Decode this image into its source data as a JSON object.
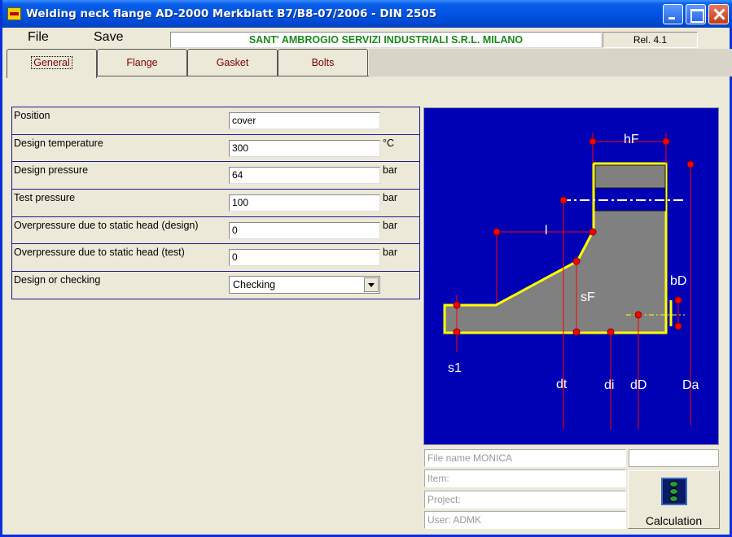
{
  "window": {
    "title": "Welding neck flange AD-2000 Merkblatt B7/B8-07/2006 - DIN 2505"
  },
  "menu": {
    "file": "File",
    "save": "Save"
  },
  "header": {
    "company": "SANT' AMBROGIO SERVIZI INDUSTRIALI S.R.L.   MILANO",
    "release": "Rel. 4.1"
  },
  "tabs": [
    {
      "label": "General",
      "active": true
    },
    {
      "label": "Flange",
      "active": false
    },
    {
      "label": "Gasket",
      "active": false
    },
    {
      "label": "Bolts",
      "active": false
    }
  ],
  "form": {
    "rows": [
      {
        "label": "Position",
        "value": "cover",
        "unit": ""
      },
      {
        "label": "Design temperature",
        "value": "300",
        "unit": "°C"
      },
      {
        "label": "Design pressure",
        "value": "64",
        "unit": "bar"
      },
      {
        "label": "Test pressure",
        "value": "100",
        "unit": "bar"
      },
      {
        "label": "Overpressure due to static head (design)",
        "value": "0",
        "unit": "bar"
      },
      {
        "label": "Overpressure due to static head (test)",
        "value": "0",
        "unit": "bar"
      },
      {
        "label": "Design or checking",
        "value": "Checking",
        "unit": ""
      }
    ]
  },
  "drawing": {
    "labels": {
      "hF": "hF",
      "l": "l",
      "sF": "sF",
      "bD": "bD",
      "s1": "s1",
      "dt": "dt",
      "di": "di",
      "dD": "dD",
      "Da": "Da"
    },
    "colors": {
      "background": "#0000b4",
      "body": "#808080",
      "outline": "#ffff00",
      "dimension": "#ff0000"
    }
  },
  "info": {
    "file_name": "File name   MONICA",
    "item": "Item:",
    "project": "Project:",
    "user": "User:    ADMK"
  },
  "calculation": {
    "label": "Calculation",
    "icon": "traffic-light-icon"
  }
}
